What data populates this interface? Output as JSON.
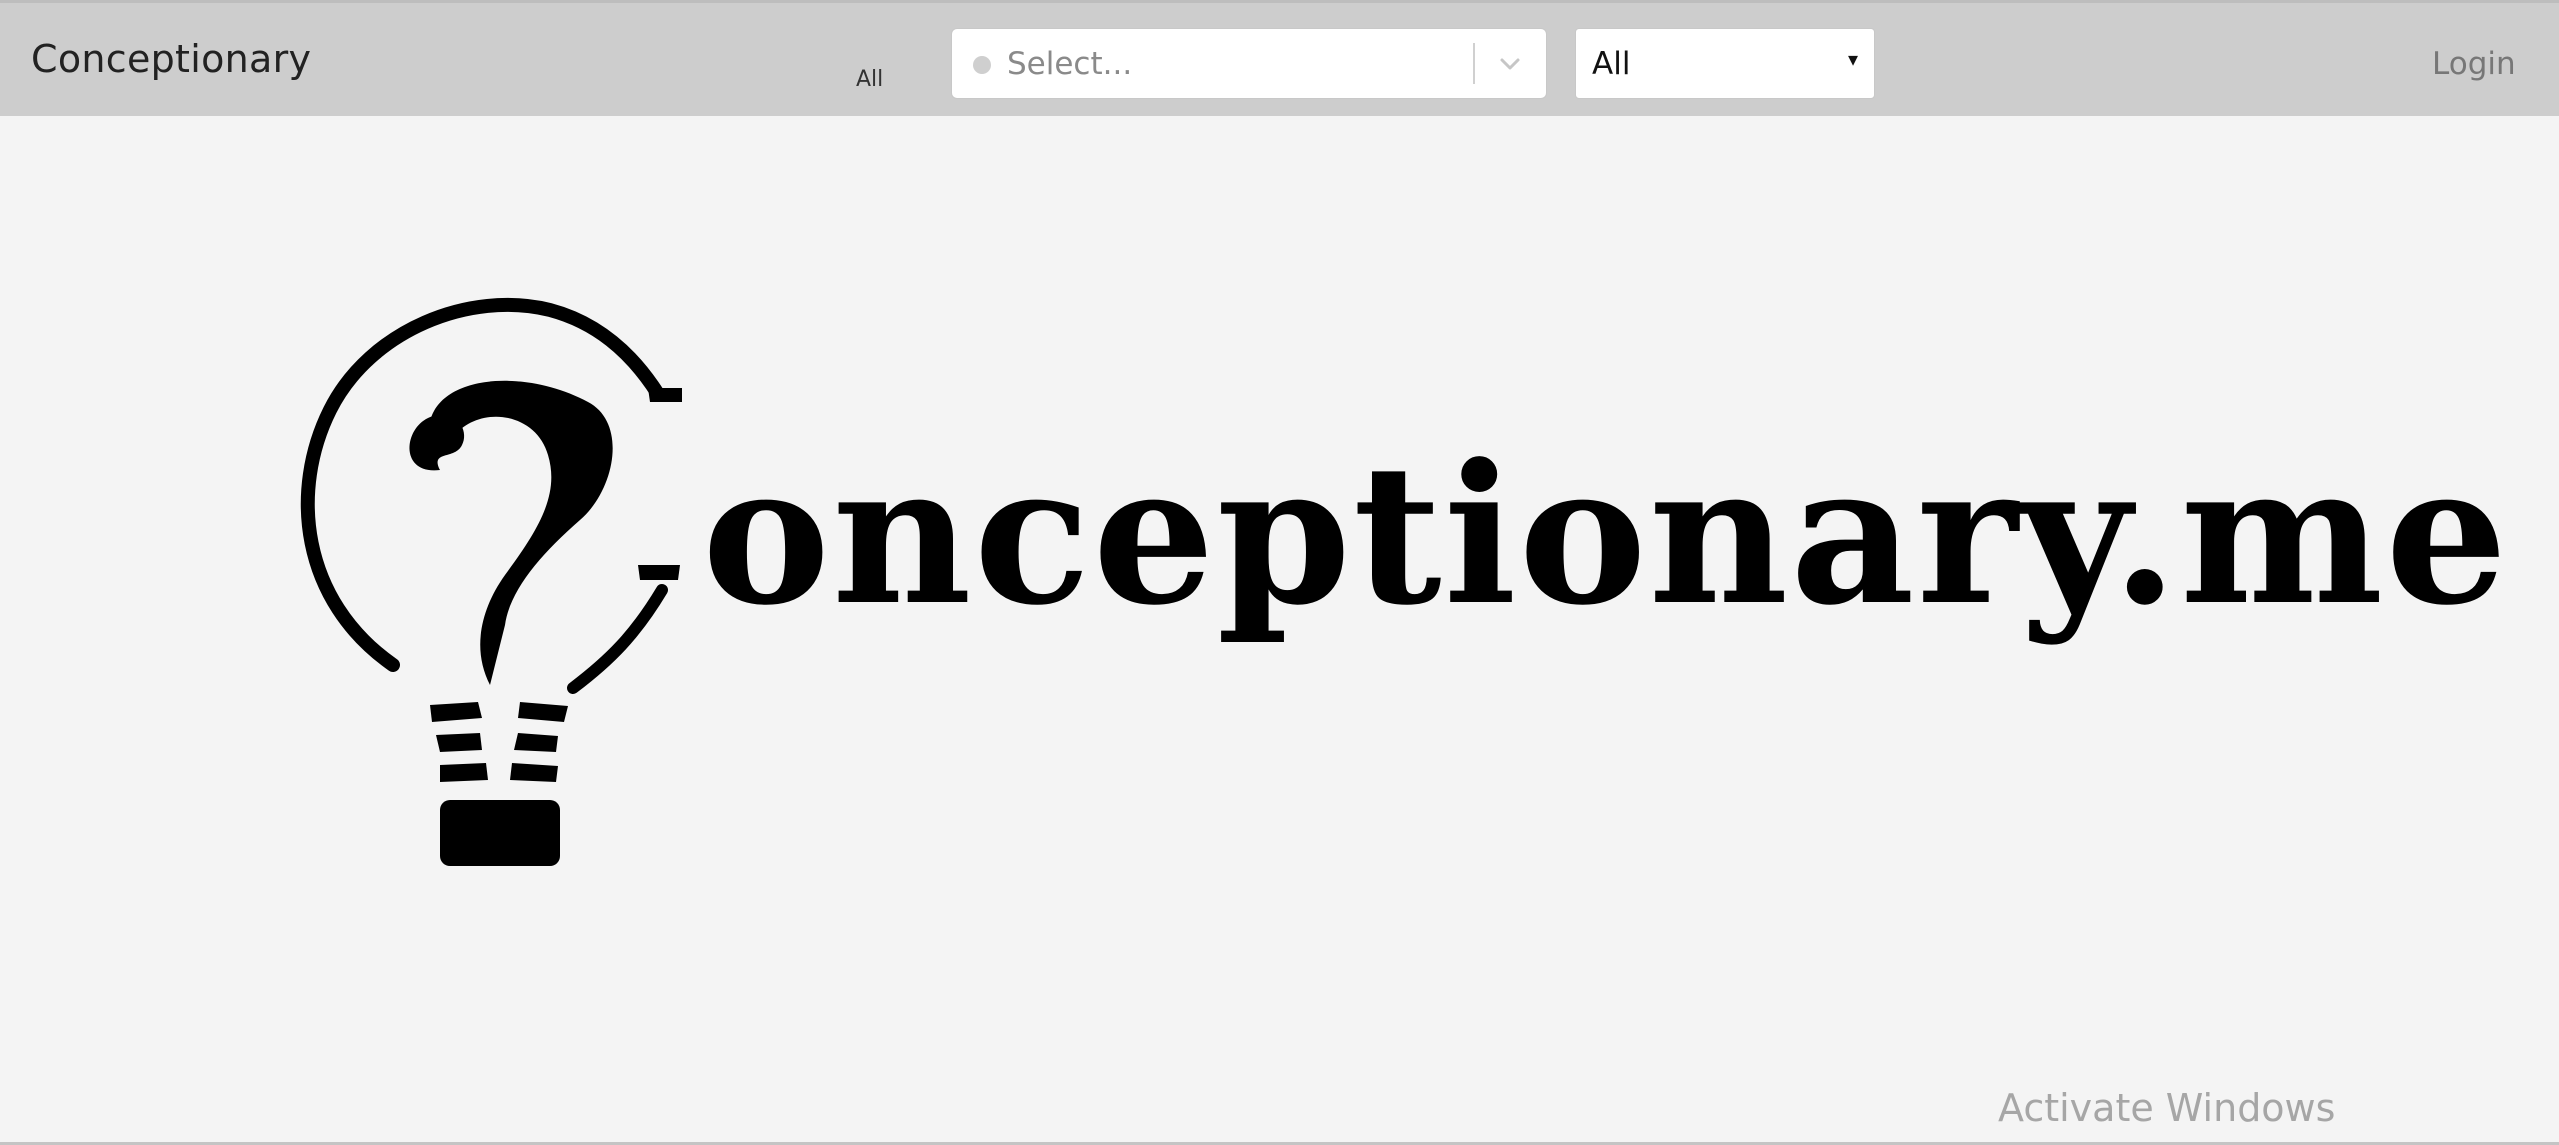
{
  "header": {
    "brand": "Conceptionary",
    "filter_label": "All",
    "search_select": {
      "placeholder": "Select..."
    },
    "category_select": {
      "value": "All",
      "arrow": "▾"
    },
    "login_label": "Login"
  },
  "hero": {
    "logo_text": "onceptionary.me",
    "logo_icon": "lightbulb-question-icon"
  },
  "system": {
    "watermark": "Activate Windows"
  },
  "colors": {
    "header_bg": "#cdcdcd",
    "page_bg": "#f4f4f4",
    "logo": "#000000"
  }
}
